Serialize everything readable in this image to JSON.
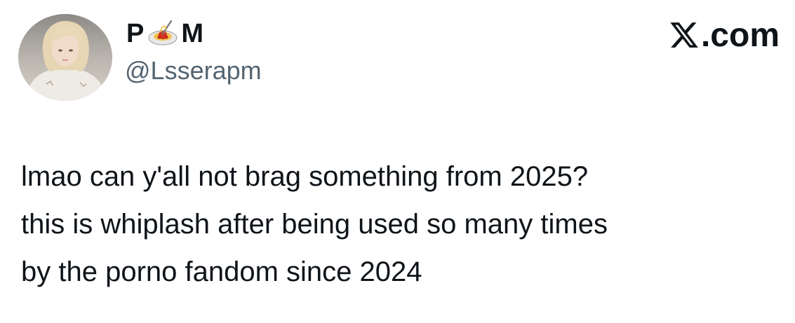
{
  "author": {
    "display_name_part1": "P",
    "display_name_emoji": "spaghetti-emoji",
    "display_name_part2": "M",
    "handle": "@Lsserapm"
  },
  "brand": {
    "label": ".com",
    "icon": "x-logo-icon"
  },
  "tweet": {
    "lines": [
      "lmao can y'all not brag something from 2025?",
      "this is whiplash after being used so many times",
      "by the porno fandom since 2024"
    ]
  },
  "colors": {
    "text": "#0f1419",
    "secondary": "#536471",
    "background": "#ffffff"
  }
}
